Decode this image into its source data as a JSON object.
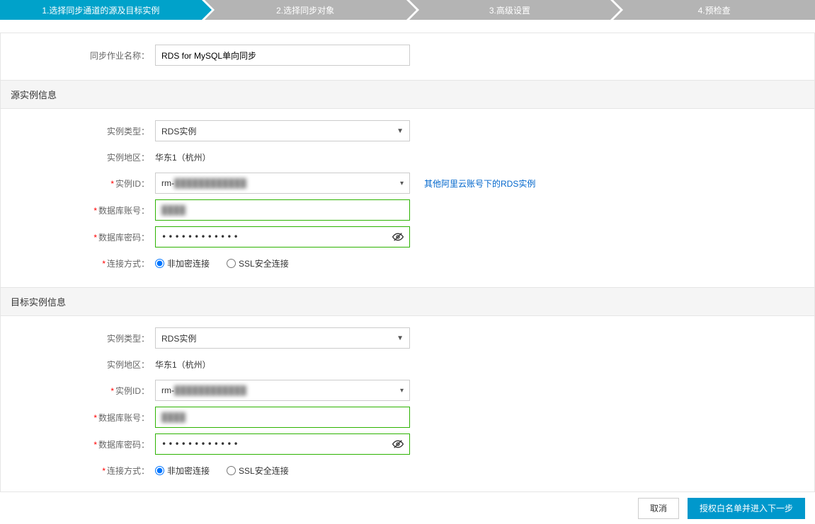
{
  "stepper": [
    "1.选择同步通道的源及目标实例",
    "2.选择同步对象",
    "3.高级设置",
    "4.预检查"
  ],
  "job": {
    "label": "同步作业名称：",
    "value": "RDS for MySQL单向同步"
  },
  "source": {
    "title": "源实例信息",
    "type_label": "实例类型：",
    "type_value": "RDS实例",
    "region_label": "实例地区：",
    "region_value": "华东1（杭州）",
    "id_label": "实例ID：",
    "id_prefix": "rm-",
    "id_blur": "████████████",
    "other_account_link": "其他阿里云账号下的RDS实例",
    "account_label": "数据库账号：",
    "account_blur": "████",
    "password_label": "数据库密码：",
    "password_dots": "••••••••••••",
    "conn_label": "连接方式：",
    "conn_opt1": "非加密连接",
    "conn_opt2": "SSL安全连接"
  },
  "target": {
    "title": "目标实例信息",
    "type_label": "实例类型：",
    "type_value": "RDS实例",
    "region_label": "实例地区：",
    "region_value": "华东1（杭州）",
    "id_label": "实例ID：",
    "id_prefix": "rm-",
    "id_blur": "████████████",
    "account_label": "数据库账号：",
    "account_blur": "████",
    "password_label": "数据库密码：",
    "password_dots": "••••••••••••",
    "conn_label": "连接方式：",
    "conn_opt1": "非加密连接",
    "conn_opt2": "SSL安全连接"
  },
  "footer": {
    "cancel": "取消",
    "next": "授权白名单并进入下一步"
  }
}
